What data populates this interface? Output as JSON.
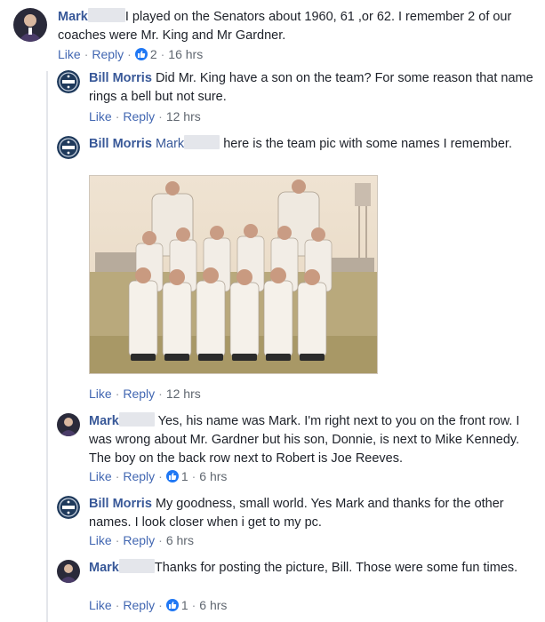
{
  "comments": [
    {
      "author": "Mark",
      "text": "I played on the Senators about 1960, 61 ,or 62. I remember 2 of our coaches were Mr. King and Mr Gardner.",
      "like_label": "Like",
      "reply_label": "Reply",
      "reactions": "2",
      "time": "16 hrs"
    },
    {
      "author": "Bill Morris",
      "text": "Did Mr. King have a son on the team? For some reason that name rings a bell but not sure.",
      "like_label": "Like",
      "reply_label": "Reply",
      "time": "12 hrs"
    },
    {
      "author": "Bill Morris",
      "mention": "Mark",
      "text": "here is the team pic with some names I remember.",
      "like_label": "Like",
      "reply_label": "Reply",
      "time": "12 hrs"
    },
    {
      "author": "Mark",
      "text": "Yes, his name was Mark. I'm right next to you on the front row. I was wrong about Mr. Gardner but his son, Donnie, is next to Mike Kennedy. The boy on the back row next to Robert is Joe Reeves.",
      "like_label": "Like",
      "reply_label": "Reply",
      "reactions": "1",
      "time": "6 hrs"
    },
    {
      "author": "Bill Morris",
      "text": "My goodness, small world. Yes Mark and thanks for the other names. I look closer when i get to my pc.",
      "like_label": "Like",
      "reply_label": "Reply",
      "time": "6 hrs"
    },
    {
      "author": "Mark",
      "text": "Thanks for posting the picture, Bill. Those were some fun times.",
      "like_label": "Like",
      "reply_label": "Reply",
      "reactions": "1",
      "time": "6 hrs"
    }
  ],
  "colors": {
    "link": "#385898",
    "action": "#4267b2",
    "meta": "#606770",
    "like_badge": "#2078f4"
  },
  "icons": [
    "like-thumb-icon",
    "avatar-photo",
    "team-logo-avatar"
  ]
}
